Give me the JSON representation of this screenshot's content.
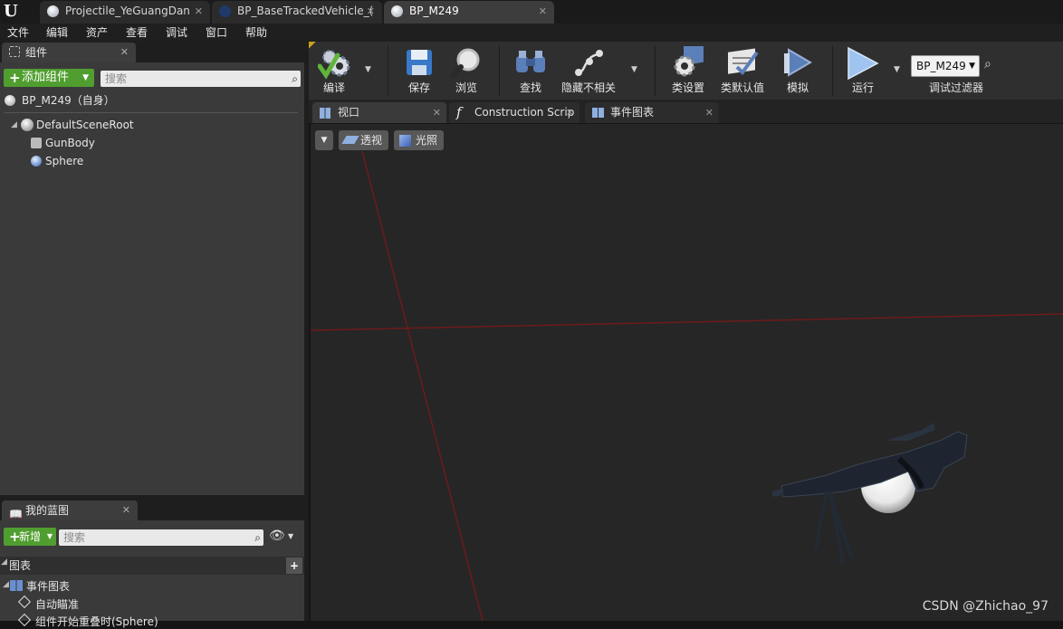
{
  "tabs": [
    {
      "label": "Projectile_YeGuangDan"
    },
    {
      "label": "BP_BaseTrackedVehicle_("
    },
    {
      "label": "BP_M249"
    }
  ],
  "menu": [
    "文件",
    "编辑",
    "资产",
    "查看",
    "调试",
    "窗口",
    "帮助"
  ],
  "components_panel": {
    "tab_label": "组件",
    "add_button": "添加组件",
    "search_placeholder": "搜索",
    "self_label": "BP_M249（自身）",
    "tree": [
      "DefaultSceneRoot",
      "GunBody",
      "Sphere"
    ]
  },
  "blueprint_panel": {
    "tab_label": "我的蓝图",
    "new_button": "新增",
    "search_placeholder": "搜索",
    "graphs_header": "图表",
    "event_graph": "事件图表",
    "items": [
      "自动瞄准",
      "组件开始重叠时(Sphere)"
    ]
  },
  "toolbar": {
    "compile": "编译",
    "save": "保存",
    "browse": "浏览",
    "find": "查找",
    "hide_unrelated": "隐藏不相关",
    "class_settings": "类设置",
    "class_defaults": "类默认值",
    "simulate": "模拟",
    "run": "运行",
    "debug_object": "BP_M249",
    "debug_filter": "调试过滤器"
  },
  "editor_tabs": [
    "视口",
    "Construction Scrip",
    "事件图表"
  ],
  "viewport": {
    "perspective": "透视",
    "lit": "光照",
    "watermark": "CSDN @Zhichao_97"
  },
  "colors": {
    "compile_ok": "#5fb53a",
    "add_green": "#4f9e2f",
    "grid_red": "#6e1a1a"
  }
}
